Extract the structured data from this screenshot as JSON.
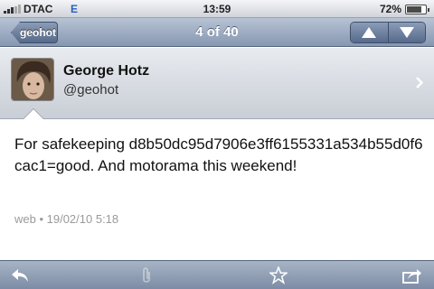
{
  "status_bar": {
    "carrier": "DTAC",
    "network": "E",
    "time": "13:59",
    "battery_percent": "72%",
    "battery_level": 0.72
  },
  "nav": {
    "back_label": "geohot",
    "title": "4 of 40"
  },
  "profile": {
    "name": "George Hotz",
    "handle": "@geohot"
  },
  "tweet": {
    "text": "For safekeeping d8b50dc95d7906e3ff6155331a534b55d0f6cac1=good. And motorama this weekend!",
    "meta": "web • 19/02/10 5:18"
  },
  "toolbar": {
    "icons": [
      "reply-icon",
      "attachment-icon",
      "star-icon",
      "share-icon"
    ]
  }
}
